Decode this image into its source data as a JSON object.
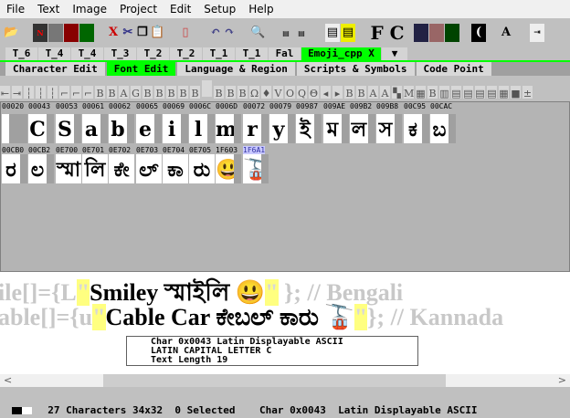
{
  "menu": [
    "File",
    "Text",
    "Image",
    "Project",
    "Edit",
    "Setup",
    "Help"
  ],
  "toolbar": {
    "fc_label": "F C"
  },
  "tabs": [
    "T_6",
    "T_4",
    "T_4",
    "T_3",
    "T_2",
    "T_2",
    "T_1",
    "T_1",
    "Fal",
    "Emoji_cpp X",
    "▼"
  ],
  "subtabs": [
    "Character Edit",
    "Font Edit",
    "Language & Region",
    "Scripts & Symbols",
    "Code Point"
  ],
  "row1": [
    {
      "code": "00020",
      "ch": " "
    },
    {
      "code": "00043",
      "ch": "C"
    },
    {
      "code": "00053",
      "ch": "S"
    },
    {
      "code": "00061",
      "ch": "a"
    },
    {
      "code": "00062",
      "ch": "b"
    },
    {
      "code": "00065",
      "ch": "e"
    },
    {
      "code": "00069",
      "ch": "i"
    },
    {
      "code": "0006C",
      "ch": "l"
    },
    {
      "code": "0006D",
      "ch": "m"
    },
    {
      "code": "00072",
      "ch": "r"
    },
    {
      "code": "00079",
      "ch": "y"
    },
    {
      "code": "00987",
      "ch": "ই"
    },
    {
      "code": "009AE",
      "ch": "ম"
    },
    {
      "code": "009B2",
      "ch": "ল"
    },
    {
      "code": "009B8",
      "ch": "স"
    },
    {
      "code": "00C95",
      "ch": "ಕ"
    },
    {
      "code": "00CAC",
      "ch": "ಬ"
    }
  ],
  "row2": [
    {
      "code": "00CB0",
      "ch": "ರ"
    },
    {
      "code": "00CB2",
      "ch": "ಲ"
    },
    {
      "code": "0E700",
      "ch": "স্মা"
    },
    {
      "code": "0E701",
      "ch": "লি"
    },
    {
      "code": "0E702",
      "ch": "ಕೇ"
    },
    {
      "code": "0E703",
      "ch": "ಲ್"
    },
    {
      "code": "0E704",
      "ch": "ಕಾ"
    },
    {
      "code": "0E705",
      "ch": "ರು"
    },
    {
      "code": "1F603",
      "ch": "😃"
    },
    {
      "code": "1F6A1",
      "ch": "🚡"
    }
  ],
  "text": {
    "line1_prefix": "ile[]={L",
    "line1_body": "Smiley স্মাইলি 😃",
    "line1_suffix": " }; // Bengali",
    "line2_prefix": "able[]={u",
    "line2_body": "Cable Car ಕೇಬಲ್ ಕಾರು 🚡",
    "line2_suffix": "}; // Kannada",
    "quote": "\""
  },
  "info": [
    "Char 0x0043  Latin Displayable ASCII",
    "LATIN CAPITAL LETTER C",
    "Text Length 19"
  ],
  "status": "27 Characters 34x32  0 Selected    Char 0x0043  Latin Displayable ASCII",
  "colors": {
    "accent": "#00ff00",
    "selected_code": "#c8c8ff",
    "quote_highlight": "#ffff80"
  }
}
